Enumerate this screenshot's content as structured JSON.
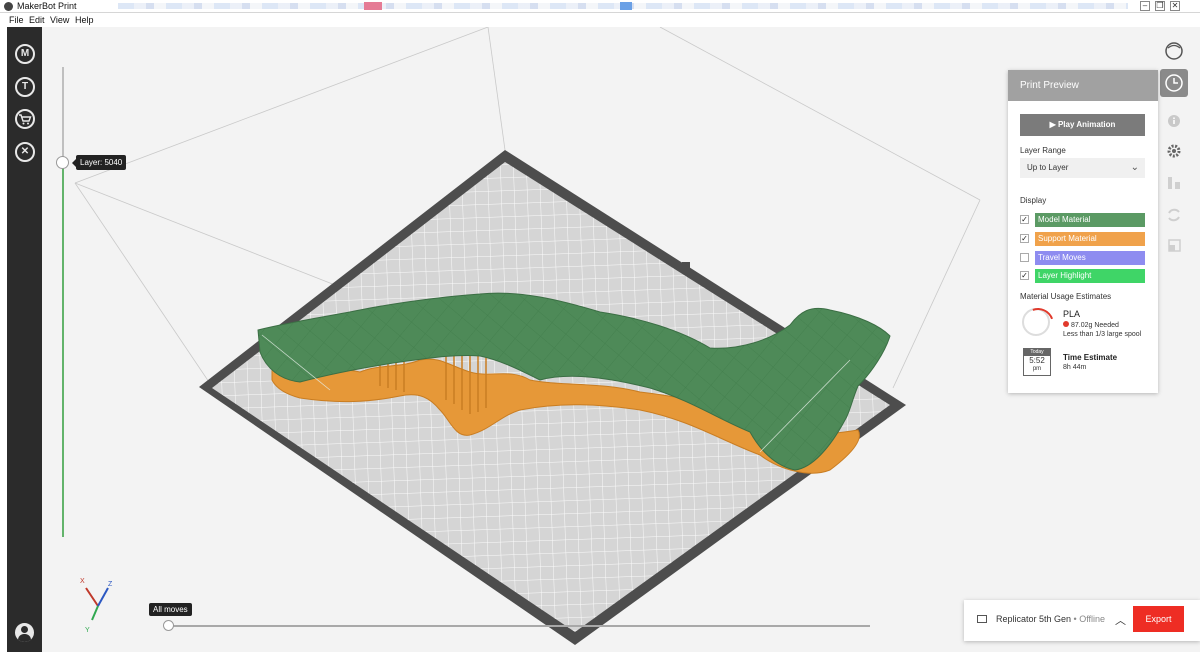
{
  "window": {
    "title": "MakerBot Print",
    "min": "–",
    "max": "❐",
    "close": "✕"
  },
  "menu": {
    "file": "File",
    "edit": "Edit",
    "view": "View",
    "help": "Help"
  },
  "sidebar": {
    "items": [
      {
        "name": "makerbot-logo-icon",
        "glyph": "M"
      },
      {
        "name": "thingiverse-icon",
        "glyph": "T"
      },
      {
        "name": "store-cart-icon",
        "glyph": "🛒"
      },
      {
        "name": "tools-icon",
        "glyph": "✕"
      }
    ]
  },
  "viewport": {
    "layer_slider": {
      "label": "Layer: 5040"
    },
    "moves_slider": {
      "label": "All moves"
    },
    "axes": {
      "x": "X",
      "y": "Y",
      "z": "Z"
    }
  },
  "right_toolbar": [
    "view-cube-icon",
    "print-preview-icon",
    "info-icon",
    "settings-gear-icon",
    "arrange-icon",
    "rotate-icon",
    "scale-icon"
  ],
  "panel": {
    "title": "Print Preview",
    "play_label": "Play Animation",
    "layer_range_label": "Layer Range",
    "layer_range_value": "Up to Layer",
    "display_label": "Display",
    "display": [
      {
        "label": "Model Material",
        "checked": "✓",
        "color": "#5b9a64"
      },
      {
        "label": "Support Material",
        "checked": "✓",
        "color": "#f0a24b"
      },
      {
        "label": "Travel Moves",
        "checked": "",
        "color": "#8e8cf0"
      },
      {
        "label": "Layer Highlight",
        "checked": "✓",
        "color": "#3fd567"
      }
    ],
    "material_label": "Material Usage Estimates",
    "material": {
      "name": "PLA",
      "needed": "87.02g  Needed",
      "note": "Less than 1/3 large spool"
    },
    "calendar": {
      "top": "Today",
      "time": "5:52",
      "ampm": "pm"
    },
    "time_title": "Time Estimate",
    "time_value": "8h 44m"
  },
  "printer": {
    "name": "Replicator 5th Gen",
    "separator": " • ",
    "status": "Offline",
    "caret": "︿",
    "export_label": "Export"
  },
  "colors": {
    "model": "#4e8a58",
    "support": "#e69838",
    "plate": "#d5d5d5",
    "frame": "#4d4d4d"
  }
}
